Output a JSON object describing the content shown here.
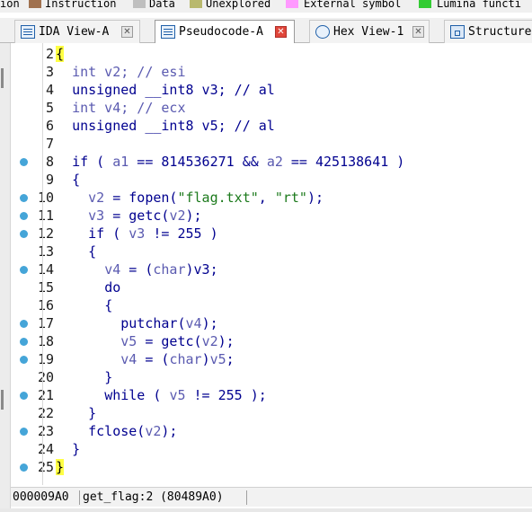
{
  "legend": [
    {
      "label": "ion",
      "color": ""
    },
    {
      "label": "Instruction",
      "color": "#a0714f"
    },
    {
      "label": "Data",
      "color": "#bfbfbf"
    },
    {
      "label": "Unexplored",
      "color": "#b9b96e"
    },
    {
      "label": "External symbol",
      "color": "#ff99ff"
    },
    {
      "label": "Lumina functi",
      "color": "#33cc33"
    }
  ],
  "tabs": [
    {
      "label": "IDA View-A",
      "active": false
    },
    {
      "label": "Pseudocode-A",
      "active": true
    },
    {
      "label": "Hex View-1",
      "active": false
    },
    {
      "label": "Structure",
      "active": false
    }
  ],
  "code": {
    "breakpoint_color": "#45a5d8",
    "highlight_color": "#ffff44",
    "lines": [
      {
        "n": "2",
        "bp": false,
        "tokens": [
          [
            "brace",
            "{"
          ]
        ]
      },
      {
        "n": "3",
        "bp": false,
        "tokens": [
          [
            "txt",
            "  "
          ],
          [
            "var",
            "int v2; // esi"
          ]
        ]
      },
      {
        "n": "4",
        "bp": false,
        "tokens": [
          [
            "txt",
            "  "
          ],
          [
            "kw",
            "unsigned __int8 v3; // al"
          ]
        ]
      },
      {
        "n": "5",
        "bp": false,
        "tokens": [
          [
            "txt",
            "  "
          ],
          [
            "var",
            "int v4; // ecx"
          ]
        ]
      },
      {
        "n": "6",
        "bp": false,
        "tokens": [
          [
            "txt",
            "  "
          ],
          [
            "kw",
            "unsigned __int8 v5; // al"
          ]
        ]
      },
      {
        "n": "7",
        "bp": false,
        "tokens": []
      },
      {
        "n": "8",
        "bp": true,
        "tokens": [
          [
            "txt",
            "  "
          ],
          [
            "kw",
            "if ( "
          ],
          [
            "var",
            "a1"
          ],
          [
            "kw",
            " == 814536271 && "
          ],
          [
            "var",
            "a2"
          ],
          [
            "kw",
            " == 425138641 )"
          ]
        ]
      },
      {
        "n": "9",
        "bp": false,
        "tokens": [
          [
            "txt",
            "  "
          ],
          [
            "kw",
            "{"
          ]
        ]
      },
      {
        "n": "10",
        "bp": true,
        "tokens": [
          [
            "txt",
            "    "
          ],
          [
            "var",
            "v2"
          ],
          [
            "kw",
            " = fopen("
          ],
          [
            "str",
            "\"flag.txt\""
          ],
          [
            "kw",
            ", "
          ],
          [
            "str",
            "\"rt\""
          ],
          [
            "kw",
            ");"
          ]
        ]
      },
      {
        "n": "11",
        "bp": true,
        "tokens": [
          [
            "txt",
            "    "
          ],
          [
            "var",
            "v3"
          ],
          [
            "kw",
            " = getc("
          ],
          [
            "var",
            "v2"
          ],
          [
            "kw",
            ");"
          ]
        ]
      },
      {
        "n": "12",
        "bp": true,
        "tokens": [
          [
            "txt",
            "    "
          ],
          [
            "kw",
            "if ( "
          ],
          [
            "var",
            "v3"
          ],
          [
            "kw",
            " != 255 )"
          ]
        ]
      },
      {
        "n": "13",
        "bp": false,
        "tokens": [
          [
            "txt",
            "    "
          ],
          [
            "kw",
            "{"
          ]
        ]
      },
      {
        "n": "14",
        "bp": true,
        "tokens": [
          [
            "txt",
            "      "
          ],
          [
            "var",
            "v4"
          ],
          [
            "kw",
            " = ("
          ],
          [
            "var",
            "char"
          ],
          [
            "kw",
            ")v3;"
          ]
        ]
      },
      {
        "n": "15",
        "bp": false,
        "tokens": [
          [
            "txt",
            "      "
          ],
          [
            "kw",
            "do"
          ]
        ]
      },
      {
        "n": "16",
        "bp": false,
        "tokens": [
          [
            "txt",
            "      "
          ],
          [
            "kw",
            "{"
          ]
        ]
      },
      {
        "n": "17",
        "bp": true,
        "tokens": [
          [
            "txt",
            "        "
          ],
          [
            "kw",
            "putchar("
          ],
          [
            "var",
            "v4"
          ],
          [
            "kw",
            ");"
          ]
        ]
      },
      {
        "n": "18",
        "bp": true,
        "tokens": [
          [
            "txt",
            "        "
          ],
          [
            "var",
            "v5"
          ],
          [
            "kw",
            " = getc("
          ],
          [
            "var",
            "v2"
          ],
          [
            "kw",
            ");"
          ]
        ]
      },
      {
        "n": "19",
        "bp": true,
        "tokens": [
          [
            "txt",
            "        "
          ],
          [
            "var",
            "v4"
          ],
          [
            "kw",
            " = ("
          ],
          [
            "var",
            "char"
          ],
          [
            "kw",
            ")"
          ],
          [
            "var",
            "v5"
          ],
          [
            "kw",
            ";"
          ]
        ]
      },
      {
        "n": "20",
        "bp": false,
        "tokens": [
          [
            "txt",
            "      "
          ],
          [
            "kw",
            "}"
          ]
        ]
      },
      {
        "n": "21",
        "bp": true,
        "tokens": [
          [
            "txt",
            "      "
          ],
          [
            "kw",
            "while ( "
          ],
          [
            "var",
            "v5"
          ],
          [
            "kw",
            " != 255 );"
          ]
        ]
      },
      {
        "n": "22",
        "bp": false,
        "tokens": [
          [
            "txt",
            "    "
          ],
          [
            "kw",
            "}"
          ]
        ]
      },
      {
        "n": "23",
        "bp": true,
        "tokens": [
          [
            "txt",
            "    "
          ],
          [
            "kw",
            "fclose("
          ],
          [
            "var",
            "v2"
          ],
          [
            "kw",
            ");"
          ]
        ]
      },
      {
        "n": "24",
        "bp": false,
        "tokens": [
          [
            "txt",
            "  "
          ],
          [
            "kw",
            "}"
          ]
        ]
      },
      {
        "n": "25",
        "bp": true,
        "tokens": [
          [
            "brace",
            "}"
          ]
        ]
      }
    ]
  },
  "status": {
    "address": "000009A0",
    "location": "get_flag:2 (80489A0)"
  }
}
